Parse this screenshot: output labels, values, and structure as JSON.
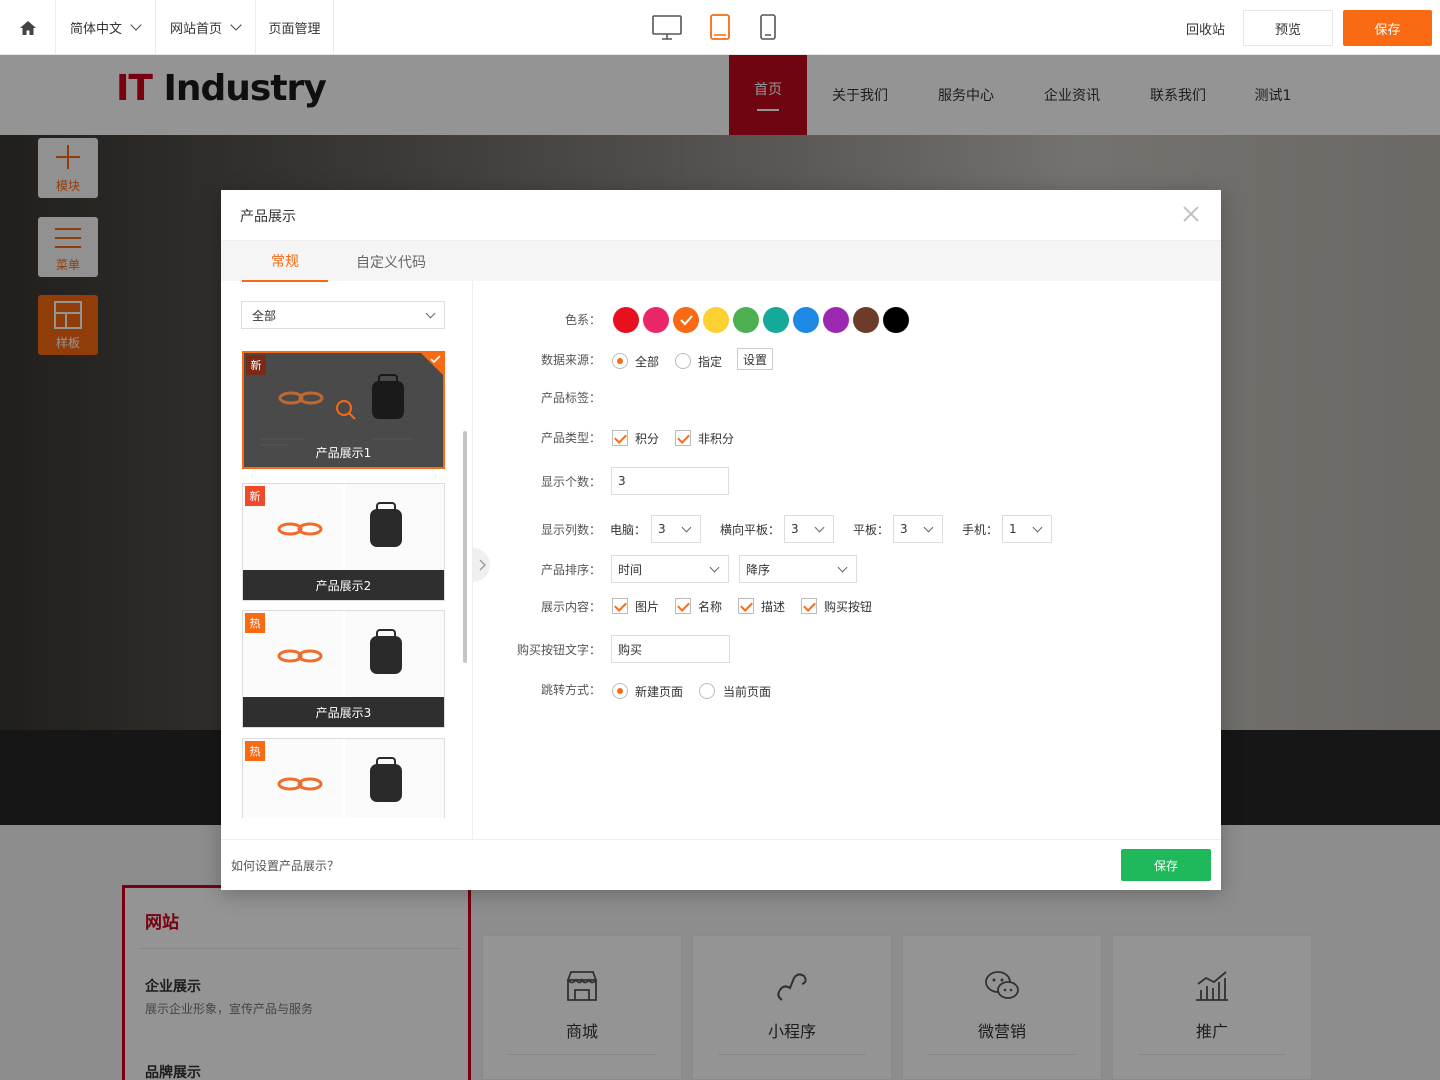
{
  "toolbar": {
    "language": "简体中文",
    "page_select": "网站首页",
    "page_manage": "页面管理",
    "recycle": "回收站",
    "preview": "预览",
    "save": "保存"
  },
  "site": {
    "logo_a": "IT",
    "logo_b": "Industry",
    "nav": [
      "首页",
      "关于我们",
      "服务中心",
      "企业资讯",
      "联系我们",
      "测试1"
    ],
    "side": [
      "模块",
      "菜单",
      "样板"
    ],
    "card_title": "网站",
    "card_item1": "企业展示",
    "card_item1_desc": "展示企业形象，宣传产品与服务",
    "card_item2": "品牌展示",
    "services": [
      "商城",
      "小程序",
      "微营销",
      "推广"
    ]
  },
  "modal": {
    "title": "产品展示",
    "tabs": [
      "常规",
      "自定义代码"
    ],
    "filter": "全部",
    "templates": [
      {
        "name": "产品展示1",
        "tag": "新"
      },
      {
        "name": "产品展示2",
        "tag": "新"
      },
      {
        "name": "产品展示3",
        "tag": "热"
      },
      {
        "name": "",
        "tag": "热"
      }
    ],
    "labels": {
      "color": "色系：",
      "source": "数据来源：",
      "tags": "产品标签：",
      "type": "产品类型：",
      "count": "显示个数：",
      "columns": "显示列数：",
      "sort": "产品排序：",
      "content": "展示内容：",
      "buy_text": "购买按钮文字：",
      "jump": "跳转方式："
    },
    "colors": [
      "#e8101e",
      "#ea2668",
      "#fa6a12",
      "#fbd232",
      "#4caf50",
      "#16a99a",
      "#1e88e5",
      "#9c27b0",
      "#6d3b2a",
      "#000000"
    ],
    "source_all": "全部",
    "source_specific": "指定",
    "set_button": "设置",
    "type_points": "积分",
    "type_nonpoints": "非积分",
    "count_value": "3",
    "col_pc_label": "电脑：",
    "col_pc": "3",
    "col_htab_label": "横向平板：",
    "col_htab": "3",
    "col_tab_label": "平板：",
    "col_tab": "3",
    "col_phone_label": "手机：",
    "col_phone": "1",
    "sort_field": "时间",
    "sort_order": "降序",
    "content_image": "图片",
    "content_name": "名称",
    "content_desc": "描述",
    "content_buy": "购买按钮",
    "buy_text_value": "购买",
    "jump_new": "新建页面",
    "jump_current": "当前页面",
    "help": "如何设置产品展示？",
    "save": "保存"
  }
}
